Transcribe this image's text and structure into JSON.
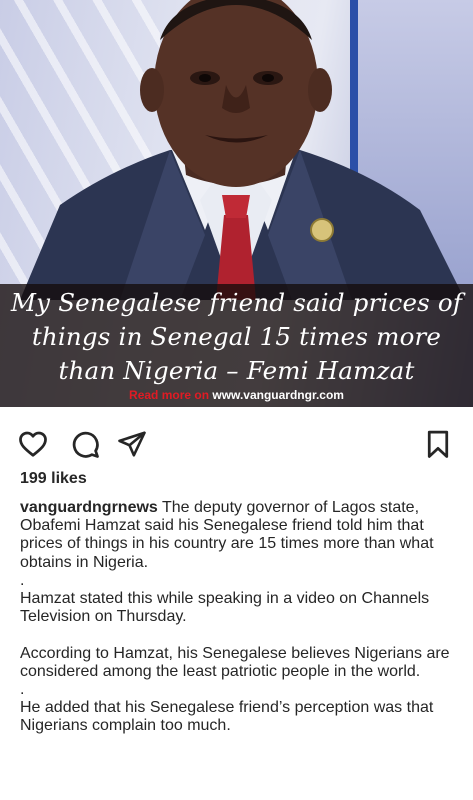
{
  "post": {
    "caption_overlay": "My Senegalese friend said prices of things in Senegal 15 times more than Nigeria – Femi Hamzat",
    "read_more_prefix": "Read more on",
    "read_more_url": "www.vanguardngr.com"
  },
  "actions": {
    "like_icon": "heart-outline-icon",
    "comment_icon": "comment-bubble-icon",
    "share_icon": "paper-plane-icon",
    "save_icon": "bookmark-outline-icon"
  },
  "likes": "199 likes",
  "caption": {
    "username": "vanguardngrnews",
    "p1": "The deputy governor of Lagos state, Obafemi Hamzat said his Senegalese friend told him that prices of things in his country are 15 times more than what obtains in Nigeria.",
    "dot1": ".",
    "p2": "Hamzat stated this while speaking in a video on Channels Television on Thursday.",
    "p3": "According to Hamzat, his Senegalese believes Nigerians are considered among the least patriotic people in the world.",
    "dot2": ".",
    "p4": "He added that his Senegalese friend’s perception was that Nigerians complain too much."
  }
}
